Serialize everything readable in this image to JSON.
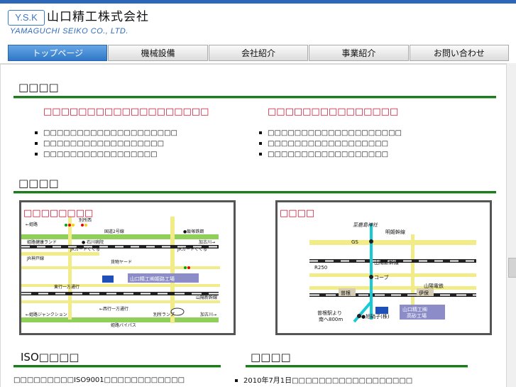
{
  "header": {
    "logo_badge": "Y.S.K",
    "company_name": "山口精工株式会社",
    "company_roman": "YAMAGUCHI SEIKO CO., LTD."
  },
  "nav": {
    "tabs": [
      {
        "label": "トップページ",
        "active": true
      },
      {
        "label": "機械設備",
        "active": false
      },
      {
        "label": "会社紹介",
        "active": false
      },
      {
        "label": "事業紹介",
        "active": false
      },
      {
        "label": "お問い合わせ",
        "active": false
      }
    ]
  },
  "sections": {
    "news_title": "□□□□",
    "access_title": "□□□□",
    "iso_title": "ISO□□□□",
    "history_title": "□□□□"
  },
  "columns": {
    "left_heading": "□□□□□□□□□□□□□□□□□□□",
    "right_heading": "□□□□□□□□□□□□□□□",
    "left_items": [
      "□□□□□□□□□□□□□□□□□□□□",
      "□□□□□□□□□□□□□□□□□□",
      "□□□□□□□□□□□□□□□□□"
    ],
    "right_items": [
      "□□□□□□□□□□□□□□□□□□□□",
      "□□□□□□□□□□□□□□□□□□",
      "□□□□□□□□□□□□□□□□□□"
    ]
  },
  "maps": {
    "himeji": {
      "title": "□□□□□□□□",
      "labels": {
        "himeji_left": "←姫路",
        "bessho_west": "別所西",
        "route2": "国道2号線",
        "railway": "●飯塚鉄鋼",
        "himeji_kenko": "姫路健康ランド",
        "ishikawa": "● 石川病院",
        "jr_guard1": "JRガードくぐる",
        "jr_guard2": "JRガードくぐる",
        "kakogawa1": "加古川→",
        "jr_kobe": "JR神戸線",
        "freight": "貨物ヤード",
        "higashi_oneway": "東行一方通行",
        "factory": "山口精工㈱姫路工場",
        "shinkansen": "山陽新幹線",
        "nishi_oneway": "←西行一方通行",
        "junction": "←姫路ジャンクション",
        "bessho_ramp": "別所ランプ",
        "kakogawa2": "加古川→",
        "bypass": "姫路バイパス"
      }
    },
    "takasago": {
      "title": "□□□□",
      "labels": {
        "shrine": "至鹿島神社",
        "meiki": "明姫幹線",
        "gs": "GS",
        "shinkansen": "山陽新幹線",
        "r250": "R250",
        "coop": "コーブ",
        "sanyo_railway": "山陽電鉄",
        "sone": "曽根",
        "iho": "伊保",
        "factory": "山口精工㈱ 高砂工場",
        "station": "曽根駅より",
        "south": "南へ800m",
        "asahi": "●旭硝子(株)"
      }
    }
  },
  "bottom": {
    "iso_text": "□□□□□□□□□ISO9001□□□□□□□□□□□□",
    "history_text": "2010年7月1日□□□□□□□□□□□□□□□□□□"
  },
  "colors": {
    "accent": "#2e66b8",
    "section_rule": "#1f7a1f",
    "subhead": "#c8102e",
    "road": "#8fcf5a",
    "minor_road": "#f2ec88",
    "factory": "#1f4fb8",
    "label_box": "#8c8cc8"
  }
}
